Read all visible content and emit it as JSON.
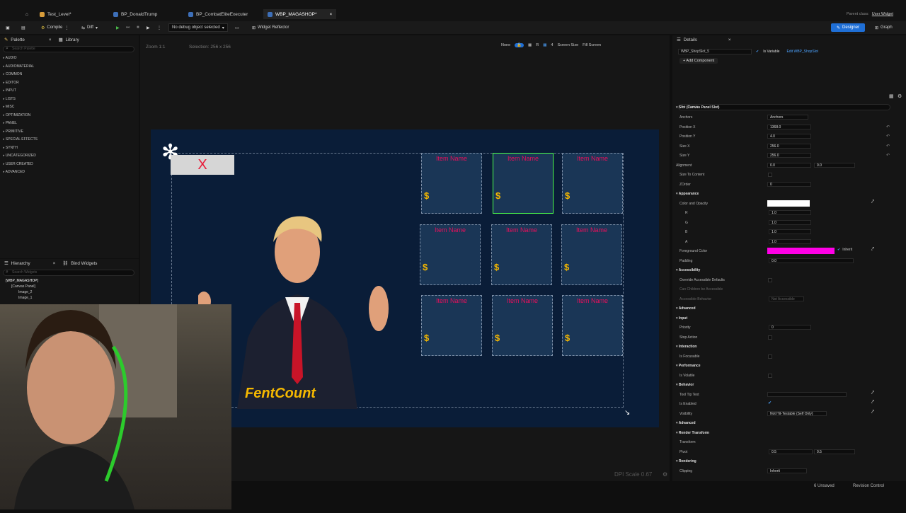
{
  "tabs": [
    {
      "label": "Test_Level*"
    },
    {
      "label": "BP_DonaldTrump"
    },
    {
      "label": "BP_CombatEliteExecuter"
    },
    {
      "label": "WBP_MAGASHOP*"
    }
  ],
  "header_right": {
    "parent_class_label": "Parent class:",
    "parent_class_value": "User Widget"
  },
  "toolbar": {
    "compile": "Compile",
    "diff": "Diff",
    "debug_select": "No debug object selected",
    "widget_reflector": "Widget Reflector",
    "designer": "Designer",
    "graph": "Graph"
  },
  "palette": {
    "tab_palette": "Palette",
    "tab_library": "Library",
    "search_placeholder": "Search Palette",
    "items": [
      "AUDIO",
      "AUDIOMATERIAL",
      "COMMON",
      "EDITOR",
      "INPUT",
      "LISTS",
      "MISC",
      "OPTIMIZATION",
      "PANEL",
      "PRIMITIVE",
      "SPECIAL EFFECTS",
      "SYNTH",
      "UNCATEGORIZED",
      "USER CREATED",
      "ADVANCED"
    ]
  },
  "hierarchy": {
    "tab_hierarchy": "Hierarchy",
    "tab_bind": "Bind Widgets",
    "search_placeholder": "Search Widgets",
    "items": [
      "[WBP_MAGASHOP]",
      "[Canvas Panel]",
      "Image_2",
      "Image_1"
    ]
  },
  "canvas": {
    "zoom": "Zoom 1:1",
    "selection": "Selection: 256 x 256",
    "none_label": "None",
    "r_label": "R",
    "four_label": "4",
    "screen_size": "Screen Size",
    "fill_screen": "Fill Screen",
    "dpi_scale": "DPI Scale 0.67",
    "close_x": "X",
    "fent_count": "FentCount",
    "slot_name": "Item Name",
    "slot_price": "$"
  },
  "details": {
    "tab": "Details",
    "widget_name": "WBP_ShopSlot_5",
    "is_variable": "Is Variable",
    "edit_link": "Edit WBP_ShopSlot",
    "add_component": "+ Add Component",
    "search_placeholder": "Search",
    "sections": {
      "slot": "Slot (Canvas Panel Slot)",
      "appearance": "Appearance",
      "accessibility": "Accessibility",
      "advanced": "Advanced",
      "input": "Input",
      "interaction": "Interaction",
      "performance": "Performance",
      "behavior": "Behavior",
      "advanced2": "Advanced",
      "render_transform": "Render Transform",
      "transform": "Transform",
      "rendering": "Rendering"
    },
    "rows": {
      "anchors": "Anchors",
      "anchors_value": "Anchors",
      "position_x": "Position X",
      "position_x_value": "1368.0",
      "position_y": "Position Y",
      "position_y_value": "4.0",
      "size_x": "Size X",
      "size_x_value": "256.0",
      "size_y": "Size Y",
      "size_y_value": "256.0",
      "alignment": "Alignment",
      "alignment_x": "0.0",
      "alignment_y": "0.0",
      "size_to_content": "Size To Content",
      "zorder": "ZOrder",
      "zorder_value": "0",
      "color_opacity": "Color and Opacity",
      "r": "R",
      "r_value": "1.0",
      "g": "G",
      "g_value": "1.0",
      "b": "B",
      "b_value": "1.0",
      "a": "A",
      "a_value": "1.0",
      "foreground_color": "Foreground Color",
      "inherit": "Inherit",
      "padding": "Padding",
      "padding_value": "0.0",
      "override_accessible": "Override Accessible Defaults",
      "can_children": "Can Children be Accessible",
      "accessible_behavior": "Accessible Behavior",
      "accessible_behavior_value": "Not Accessible",
      "priority": "Priority",
      "priority_value": "0",
      "stop_action": "Stop Action",
      "is_focusable": "Is Focusable",
      "is_volatile": "Is Volatile",
      "tooltip": "Tool Tip Text",
      "is_enabled": "Is Enabled",
      "visibility": "Visibility",
      "visibility_value": "Not Hit-Testable (Self Only)",
      "pivot": "Pivot",
      "pivot_x": "0.5",
      "pivot_y": "0.5",
      "clipping": "Clipping",
      "clipping_value": "Inherit"
    }
  },
  "statusbar": {
    "unsaved": "6 Unsaved",
    "revision": "Revision Control"
  },
  "colors": {
    "accent": "#1f6fd6",
    "slot_bg": "#1a3656",
    "item_name": "#e8105c",
    "price": "#f5b800",
    "foreground": "#ff00e6",
    "selected_border": "#4cff4c"
  }
}
